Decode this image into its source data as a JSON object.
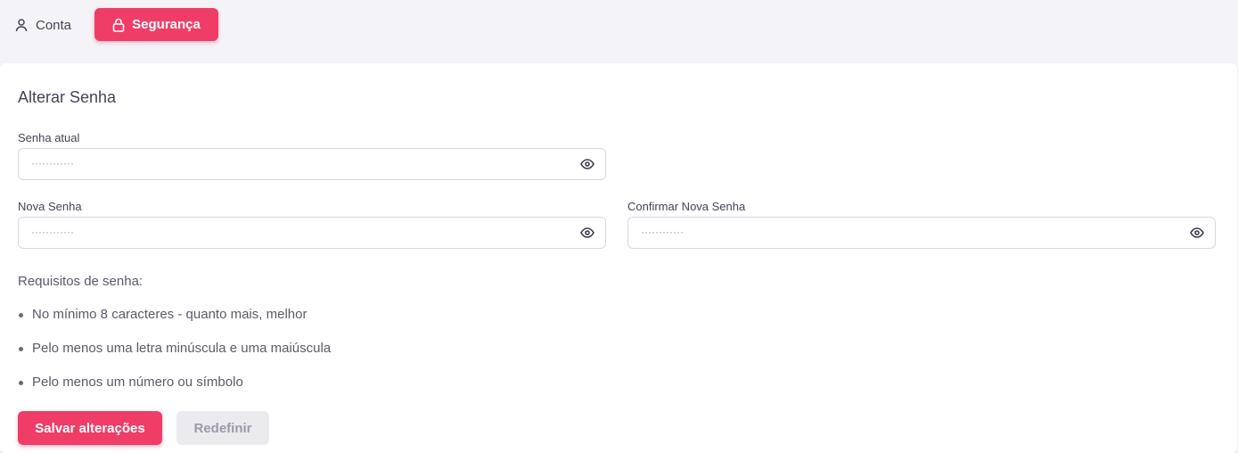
{
  "tabs": {
    "conta": {
      "label": "Conta",
      "icon": "user-icon"
    },
    "seguranca": {
      "label": "Segurança",
      "icon": "lock-icon",
      "active": true
    }
  },
  "card": {
    "title": "Alterar Senha"
  },
  "fields": {
    "current": {
      "label": "Senha atual",
      "value": "············",
      "icon": "eye-icon"
    },
    "new": {
      "label": "Nova Senha",
      "value": "············",
      "icon": "eye-icon"
    },
    "confirm": {
      "label": "Confirmar Nova Senha",
      "value": "············",
      "icon": "eye-icon"
    }
  },
  "requirements": {
    "title": "Requisitos de senha:",
    "items": [
      "No mínimo 8 caracteres - quanto mais, melhor",
      "Pelo menos uma letra minúscula e uma maiúscula",
      "Pelo menos um número ou símbolo"
    ]
  },
  "buttons": {
    "save": "Salvar alterações",
    "reset": "Redefinir"
  },
  "colors": {
    "accent": "#ef3d67",
    "background": "#f4f4f8",
    "card": "#ffffff",
    "muted_button": "#ebebef"
  }
}
